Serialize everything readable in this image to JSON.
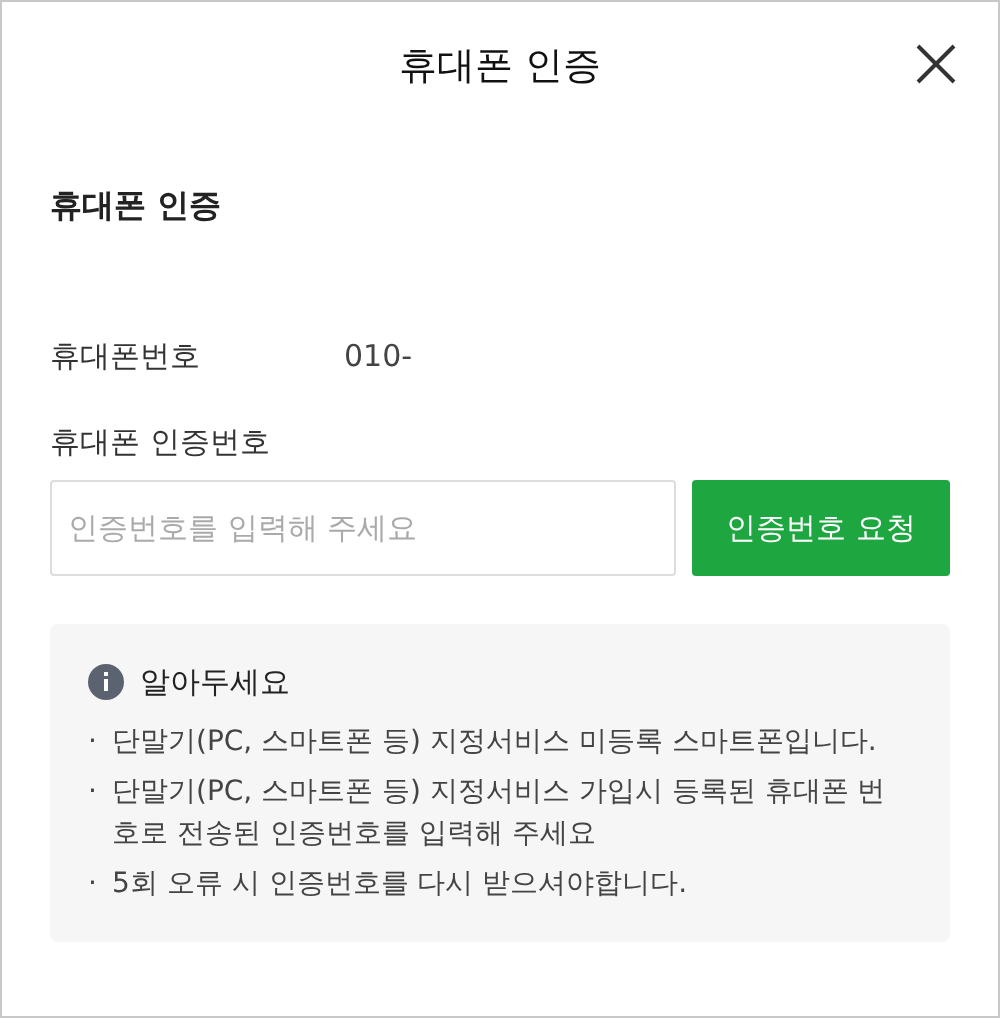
{
  "window": {
    "title": "휴대폰 인증"
  },
  "section_title": "휴대폰 인증",
  "phone": {
    "label": "휴대폰번호",
    "value": "010-"
  },
  "code": {
    "label": "휴대폰 인증번호",
    "placeholder": "인증번호를 입력해 주세요",
    "button": "인증번호 요청"
  },
  "notice": {
    "title": "알아두세요",
    "items": [
      {
        "bullet": "·",
        "text": "단말기(PC, 스마트폰 등) 지정서비스 미등록 스마트폰입니다."
      },
      {
        "bullet": "·",
        "text": "단말기(PC, 스마트폰 등) 지정서비스 가입시 등록된 휴대폰 번호로 전송된 인증번호를 입력해 주세요"
      },
      {
        "bullet": "·",
        "text": "5회 오류 시 인증번호를 다시 받으셔야합니다."
      }
    ]
  }
}
